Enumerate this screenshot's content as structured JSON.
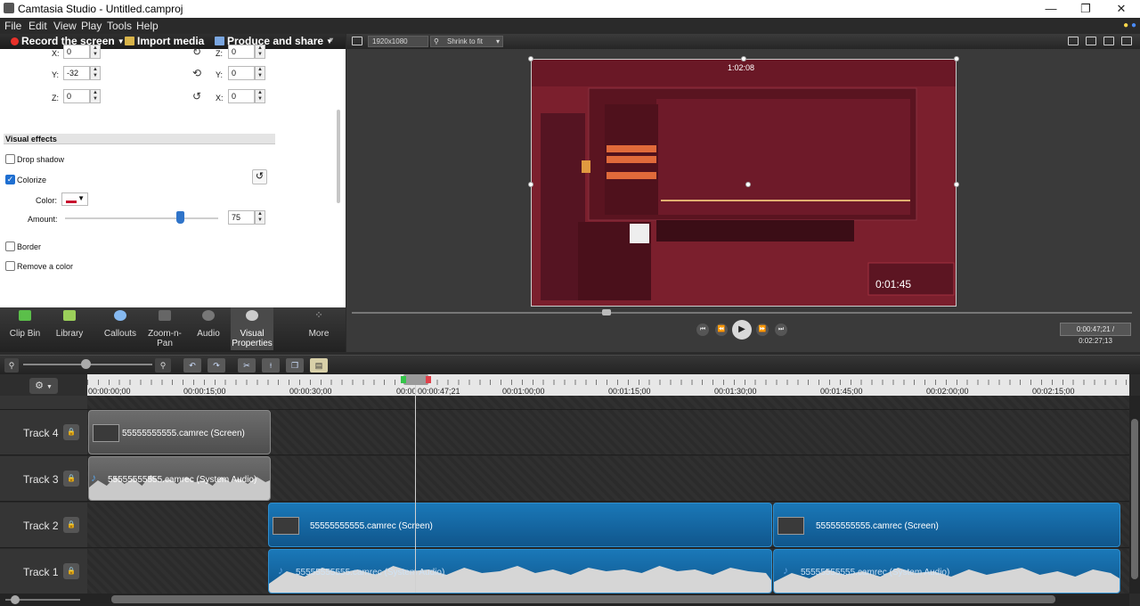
{
  "window": {
    "title": "Camtasia Studio - Untitled.camproj",
    "minimize": "—",
    "maximize": "❐",
    "close": "✕"
  },
  "menu": [
    "File",
    "Edit",
    "View",
    "Play",
    "Tools",
    "Help"
  ],
  "toolbar": {
    "record_label": "Record the screen",
    "import_label": "Import media",
    "produce_label": "Produce and share"
  },
  "properties": {
    "x_label": "X:",
    "x_value": "0",
    "y_label": "Y:",
    "y_value": "-32",
    "z_label": "Z:",
    "z_value": "0",
    "rot_z_label": "Z:",
    "rot_z_value": "0",
    "rot_y_label": "Y:",
    "rot_y_value": "0",
    "rot_x_label": "X:",
    "rot_x_value": "0",
    "section_title": "Visual effects",
    "drop_shadow": "Drop shadow",
    "drop_shadow_checked": false,
    "colorize": "Colorize",
    "colorize_checked": true,
    "color_label": "Color:",
    "colorize_color": "#c8102e",
    "amount_label": "Amount:",
    "amount_value": "75",
    "amount_fraction": 0.75,
    "border": "Border",
    "border_checked": false,
    "remove_color": "Remove a color",
    "remove_color_checked": false
  },
  "tabs": [
    {
      "label": "Clip Bin",
      "icon": "clip-bin-icon"
    },
    {
      "label": "Library",
      "icon": "library-icon"
    },
    {
      "label": "Callouts",
      "icon": "callouts-icon"
    },
    {
      "label": "Zoom-n-Pan",
      "icon": "zoom-n-pan-icon"
    },
    {
      "label": "Audio",
      "icon": "audio-icon"
    },
    {
      "label": "Visual Properties",
      "icon": "visual-properties-icon",
      "active": true
    },
    {
      "label": "More",
      "icon": "more-icon"
    }
  ],
  "preview": {
    "resolution": "1920x1080",
    "zoom": "Shrink to fit",
    "time_display": "0:00:47;21 / 0:02:27;13",
    "canvas_timer": "0:01:45",
    "canvas_timer_top": "1:02:08"
  },
  "timeline": {
    "ruler_labels": [
      "00:00:00;00",
      "00:00:15;00",
      "00:00:30;00",
      "00:00",
      "00:00:47;21",
      "00:01:00;00",
      "00:01:15;00",
      "00:01:30;00",
      "00:01:45;00",
      "00:02:00;00",
      "00:02:15;00"
    ],
    "tracks": [
      {
        "name": "Track 4",
        "clips": [
          {
            "label": "55555555555.camrec (Screen)",
            "kind": "video",
            "color": "gray"
          }
        ]
      },
      {
        "name": "Track 3",
        "clips": [
          {
            "label": "55555555555.camrec (System Audio)",
            "kind": "audio",
            "color": "gray"
          }
        ]
      },
      {
        "name": "Track 2",
        "clips": [
          {
            "label": "55555555555.camrec (Screen)",
            "kind": "video",
            "color": "blue"
          },
          {
            "label": "55555555555.camrec (Screen)",
            "kind": "video",
            "color": "blue"
          }
        ]
      },
      {
        "name": "Track 1",
        "clips": [
          {
            "label": "55555555555.camrec (System Audio)",
            "kind": "audio",
            "color": "blue"
          },
          {
            "label": "55555555555.camrec (System Audio)",
            "kind": "audio",
            "color": "blue"
          }
        ]
      }
    ]
  },
  "colors": {
    "accent_blue": "#1a78b8",
    "record_red": "#e8312a"
  }
}
